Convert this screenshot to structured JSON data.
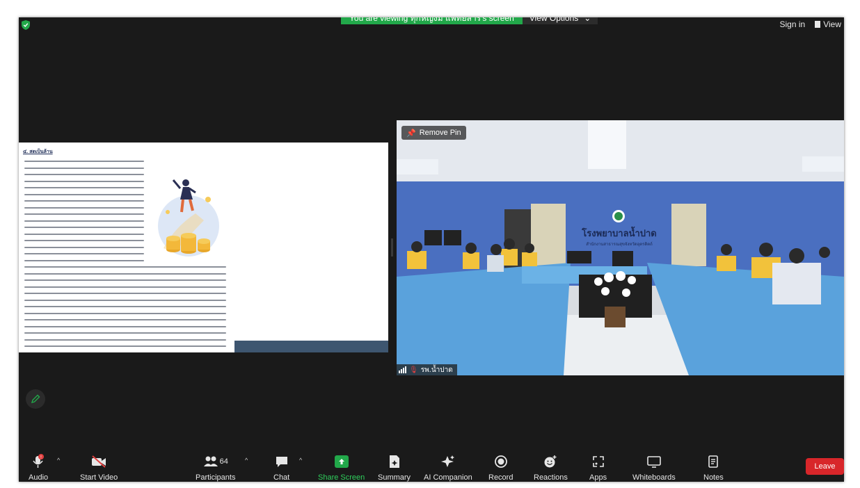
{
  "meeting": {
    "viewing_banner": "You are viewing ทุกหญิงมี แพทย์สาร's screen",
    "view_options": "View Options",
    "sign_in": "Sign in",
    "view": "View"
  },
  "shared_doc": {
    "heading": "๔. สดเป็นล้าน"
  },
  "video": {
    "remove_pin": "Remove Pin",
    "participant_name": "รพ.น้ำปาด",
    "sign_title": "โรงพยาบาลน้ำปาด",
    "sign_subtitle": "สำนักงานสาธารณสุขจังหวัดอุตรดิตถ์"
  },
  "toolbar": {
    "audio": "Audio",
    "start_video": "Start Video",
    "participants": "Participants",
    "participants_count": "64",
    "chat": "Chat",
    "share_screen": "Share Screen",
    "summary": "Summary",
    "ai_companion": "AI Companion",
    "record": "Record",
    "reactions": "Reactions",
    "apps": "Apps",
    "whiteboards": "Whiteboards",
    "notes": "Notes",
    "leave": "Leave"
  },
  "colors": {
    "banner_green": "#22a84a",
    "leave_red": "#d8262a",
    "meeting_bg": "#1a1a1a"
  }
}
